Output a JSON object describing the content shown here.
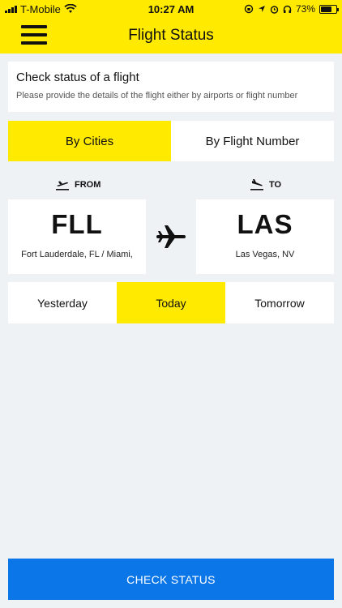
{
  "status_bar": {
    "carrier": "T-Mobile",
    "time": "10:27 AM",
    "battery": "73%",
    "battery_level": 0.73
  },
  "header": {
    "title": "Flight Status",
    "menu_icon": "hamburger-menu-icon"
  },
  "info": {
    "title": "Check status of a flight",
    "subtitle": "Please provide the details of the flight either by airports or flight number"
  },
  "tabs": [
    {
      "label": "By Cities",
      "active": true
    },
    {
      "label": "By Flight Number",
      "active": false
    }
  ],
  "route": {
    "from_label": "FROM",
    "to_label": "TO",
    "from": {
      "code": "FLL",
      "city": "Fort Lauderdale, FL / Miami,"
    },
    "to": {
      "code": "LAS",
      "city": "Las Vegas, NV"
    }
  },
  "days": [
    {
      "label": "Yesterday",
      "active": false
    },
    {
      "label": "Today",
      "active": true
    },
    {
      "label": "Tomorrow",
      "active": false
    }
  ],
  "action": {
    "check_label": "CHECK STATUS"
  },
  "colors": {
    "accent": "#ffea00",
    "primary": "#0b76e8",
    "background": "#eef2f5"
  }
}
